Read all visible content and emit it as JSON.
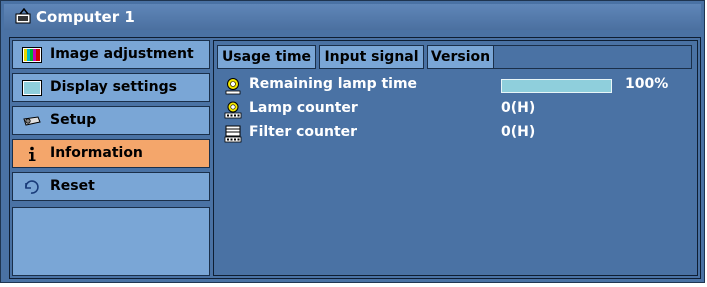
{
  "window": {
    "title": "Computer 1"
  },
  "sidebar": {
    "items": [
      {
        "label": "Image adjustment",
        "icon": "color-bars-icon"
      },
      {
        "label": "Display settings",
        "icon": "monitor-icon"
      },
      {
        "label": "Setup",
        "icon": "projector-icon"
      },
      {
        "label": "Information",
        "icon": "info-icon",
        "active": true
      },
      {
        "label": "Reset",
        "icon": "reset-icon"
      }
    ]
  },
  "tabs": [
    {
      "label": "Usage time",
      "active": true
    },
    {
      "label": "Input signal"
    },
    {
      "label": "Version"
    }
  ],
  "usage": {
    "remaining_lamp": {
      "label": "Remaining lamp time",
      "value": "100%",
      "level": 1.0
    },
    "lamp_counter": {
      "label": "Lamp counter",
      "value": "0(H)"
    },
    "filter_counter": {
      "label": "Filter counter",
      "value": "0(H)"
    }
  },
  "colors": {
    "background": "#4a72a4",
    "menu_item": "#7aa6d6",
    "menu_active": "#f4a66b",
    "progress": "#8fcfdc"
  }
}
